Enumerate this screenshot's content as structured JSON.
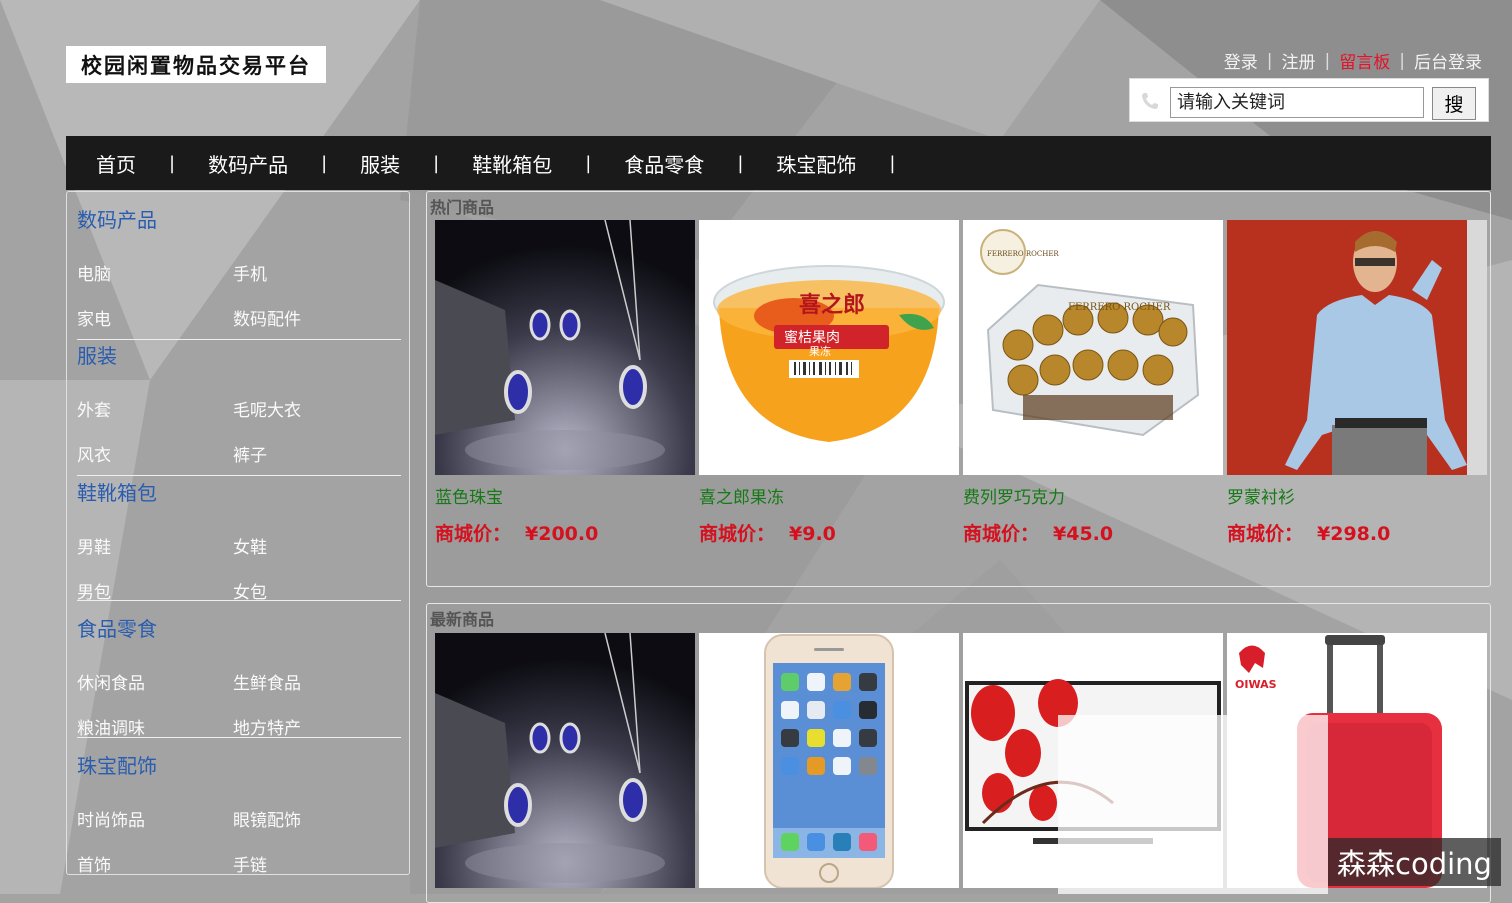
{
  "brand": {
    "logo_text": "校园闲置物品交易平台"
  },
  "top_links": {
    "login": "登录",
    "register": "注册",
    "message_board": "留言板",
    "admin_login": "后台登录",
    "separator": "|"
  },
  "search": {
    "placeholder": "请输入关键词",
    "button": "搜"
  },
  "nav": {
    "separator": "|",
    "items": [
      "首页",
      "数码产品",
      "服装",
      "鞋靴箱包",
      "食品零食",
      "珠宝配饰"
    ]
  },
  "sidebar": {
    "categories": [
      {
        "title": "数码产品",
        "subs": [
          "电脑",
          "手机",
          "家电",
          "数码配件"
        ]
      },
      {
        "title": "服装",
        "subs": [
          "外套",
          "毛呢大衣",
          "风衣",
          "裤子"
        ]
      },
      {
        "title": "鞋靴箱包",
        "subs": [
          "男鞋",
          "女鞋",
          "男包",
          "女包"
        ]
      },
      {
        "title": "食品零食",
        "subs": [
          "休闲食品",
          "生鲜食品",
          "粮油调味",
          "地方特产"
        ]
      },
      {
        "title": "珠宝配饰",
        "subs": [
          "时尚饰品",
          "眼镜配饰",
          "首饰",
          "手链"
        ]
      }
    ]
  },
  "hot": {
    "title": "热门商品",
    "price_label": "商城价：",
    "products": [
      {
        "name": "蓝色珠宝",
        "price": "¥200.0",
        "image": "jewelry"
      },
      {
        "name": "喜之郎果冻",
        "price": "¥9.0",
        "image": "jelly"
      },
      {
        "name": "费列罗巧克力",
        "price": "¥45.0",
        "image": "chocolate"
      },
      {
        "name": "罗蒙衬衫",
        "price": "¥298.0",
        "image": "shirt"
      }
    ]
  },
  "newest": {
    "title": "最新商品",
    "products": [
      {
        "image": "jewelry"
      },
      {
        "image": "iphone"
      },
      {
        "image": "tv"
      },
      {
        "image": "luggage"
      }
    ]
  },
  "image_text": {
    "jelly_brand": "喜之郎",
    "jelly_label": "蜜桔果肉",
    "jelly_sub": "果冻",
    "ferrero": "FERRERO ROCHER",
    "luggage_brand": "OIWAS"
  },
  "watermark": "森森coding"
}
